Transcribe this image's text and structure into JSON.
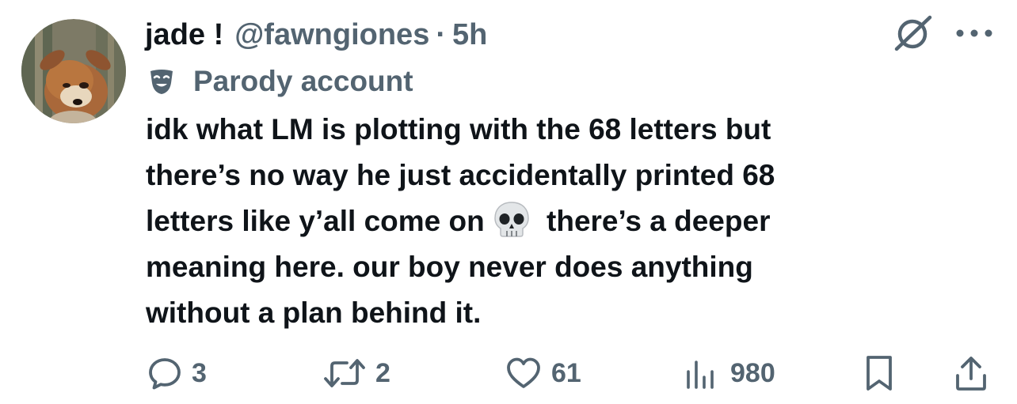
{
  "post": {
    "display_name": "jade !",
    "handle": "@fawngiones",
    "separator": "·",
    "time": "5h",
    "label": "Parody account",
    "label_icon": "theater-mask-icon",
    "text_lines": [
      "idk what LM is plotting with the 68 letters but",
      "there’s no way he just accidentally printed 68",
      "letters like y’all come on",
      "there’s a deeper",
      "meaning here. our boy never does anything",
      "without a plan behind it."
    ],
    "emoji": "skull-emoji"
  },
  "actions": {
    "replies": "3",
    "reposts": "2",
    "likes": "61",
    "views": "980"
  },
  "colors": {
    "text": "#0f1419",
    "secondary": "#536471"
  }
}
